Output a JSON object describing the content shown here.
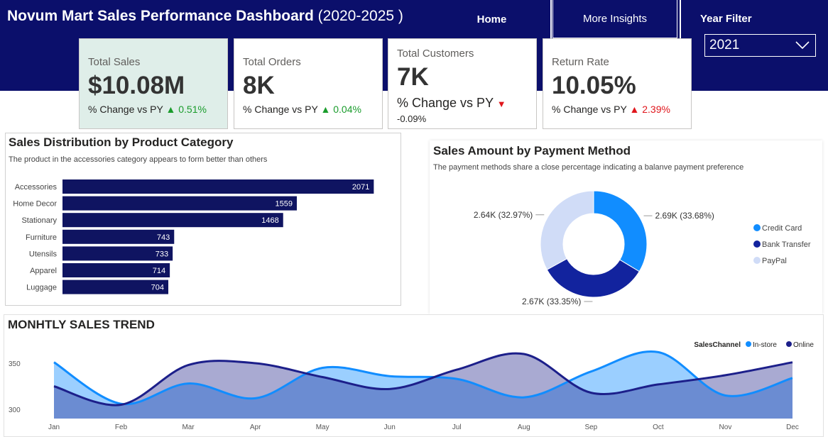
{
  "header": {
    "title_bold": "Novum Mart Sales Performance Dashboard",
    "title_years": "(2020-2025 )",
    "nav": {
      "home": "Home",
      "more": "More Insights"
    },
    "year_filter": {
      "label": "Year Filter",
      "selected": "2021"
    }
  },
  "kpis": [
    {
      "label": "Total Sales",
      "value": "$10.08M",
      "change_label": "% Change vs PY",
      "direction": "up",
      "change": "0.51%"
    },
    {
      "label": "Total Orders",
      "value": "8K",
      "change_label": "% Change vs PY",
      "direction": "up",
      "change": "0.04%"
    },
    {
      "label": "Total Customers",
      "value": "7K",
      "change_label": "% Change vs PY",
      "direction": "down",
      "change": "-0.09%"
    },
    {
      "label": "Return Rate",
      "value": "10.05%",
      "change_label": "% Change vs PY",
      "direction": "up",
      "change": "2.39%"
    }
  ],
  "category_panel": {
    "title": "Sales Distribution by Product Category",
    "subtitle": "The product in the accessories category appears to form better than others"
  },
  "payment_panel": {
    "title": "Sales Amount by Payment Method",
    "subtitle": "The payment methods share a close percentage indicating a balanve payment preference"
  },
  "trend_panel": {
    "title": "MONHTLY SALES TREND",
    "legend_title": "SalesChannel"
  },
  "colors": {
    "navy": "#0b0f6b",
    "bar": "#0f1461",
    "up": "#1a9c2c",
    "down": "#e0161c",
    "credit_card": "#118dff",
    "bank_transfer": "#12239e",
    "paypal": "#d0dcf7",
    "in_store": "#118dff",
    "online": "#1c1f8a"
  },
  "chart_data": [
    {
      "type": "bar",
      "orientation": "horizontal",
      "categories": [
        "Accessories",
        "Home Decor",
        "Stationary",
        "Furniture",
        "Utensils",
        "Apparel",
        "Luggage"
      ],
      "values": [
        2071,
        1559,
        1468,
        743,
        733,
        714,
        704
      ],
      "xlim": [
        0,
        2400
      ]
    },
    {
      "type": "pie",
      "style": "donut",
      "series": [
        {
          "name": "Credit Card",
          "value": 2.69,
          "label": "2.69K (33.68%)"
        },
        {
          "name": "Bank Transfer",
          "value": 2.67,
          "label": "2.67K (33.35%)"
        },
        {
          "name": "PayPal",
          "value": 2.64,
          "label": "2.64K (32.97%)"
        }
      ],
      "legend": "right"
    },
    {
      "type": "area",
      "categories": [
        "Jan",
        "Feb",
        "Mar",
        "Apr",
        "May",
        "Jun",
        "Jul",
        "Aug",
        "Sep",
        "Oct",
        "Nov",
        "Dec"
      ],
      "series": [
        {
          "name": "In-store",
          "values": [
            351,
            306,
            328,
            312,
            345,
            336,
            333,
            313,
            341,
            362,
            315,
            334
          ]
        },
        {
          "name": "Online",
          "values": [
            325,
            305,
            348,
            350,
            335,
            322,
            343,
            360,
            318,
            327,
            337,
            351
          ]
        }
      ],
      "yticks": [
        300,
        350
      ],
      "ylim": [
        290,
        370
      ],
      "legend": "top-right"
    }
  ]
}
